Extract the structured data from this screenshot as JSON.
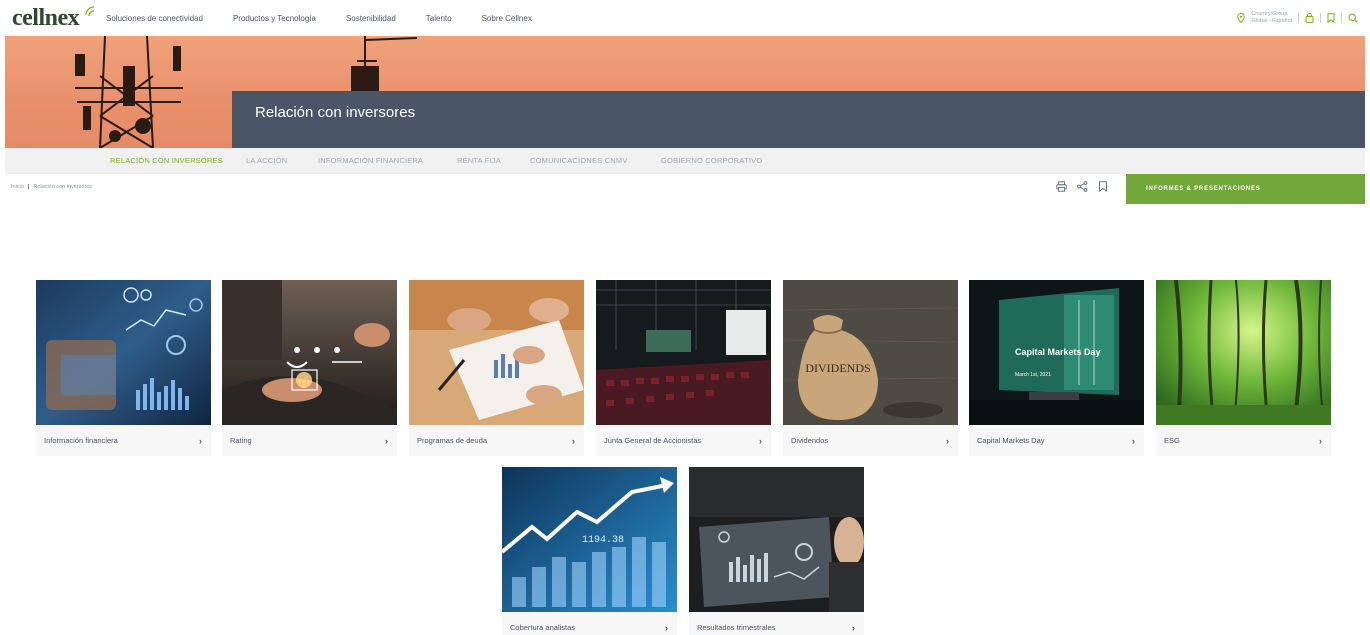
{
  "header": {
    "logo_text": "cellnex",
    "nav": [
      "Soluciones de conectividad",
      "Productos y Tecnología",
      "Sostenibilidad",
      "Talento",
      "Sobre Cellnex"
    ],
    "location_label": "Country/Group",
    "location_value": "Global - Español"
  },
  "hero": {
    "title": "Relación con inversores"
  },
  "subnav": [
    "RELACIÓN CON INVERSORES",
    "LA ACCIÓN",
    "INFORMACIÓN FINANCIERA",
    "RENTA FIJA",
    "COMUNICACIONES CNMV",
    "GOBIERNO CORPORATIVO"
  ],
  "breadcrumb": {
    "home": "Inicio",
    "current": "Relación con inversores"
  },
  "cta_label": "INFORMES & PRESENTACIONES",
  "cards": [
    {
      "label": "Información financiera"
    },
    {
      "label": "Rating"
    },
    {
      "label": "Programas de deuda"
    },
    {
      "label": "Junta General de Accionistas"
    },
    {
      "label": "Dividendos",
      "image_text": "DIVIDENDS"
    },
    {
      "label": "Capital Markets Day",
      "image_text": "Capital Markets Day",
      "image_subtext": "March 1st, 2021"
    },
    {
      "label": "ESG"
    },
    {
      "label": "Cobertura analistas",
      "image_text": "1194.38"
    },
    {
      "label": "Resultados trimestrales"
    }
  ],
  "colors": {
    "brand_green": "#72a83a",
    "hero_orange": "#e9906b",
    "hero_panel": "#4a5668",
    "subnav_bg": "#f1f1f1"
  },
  "icons": [
    "location-pin-icon",
    "user-icon",
    "bookmark-icon",
    "search-icon",
    "print-icon",
    "share-icon",
    "chevron-right-icon"
  ]
}
